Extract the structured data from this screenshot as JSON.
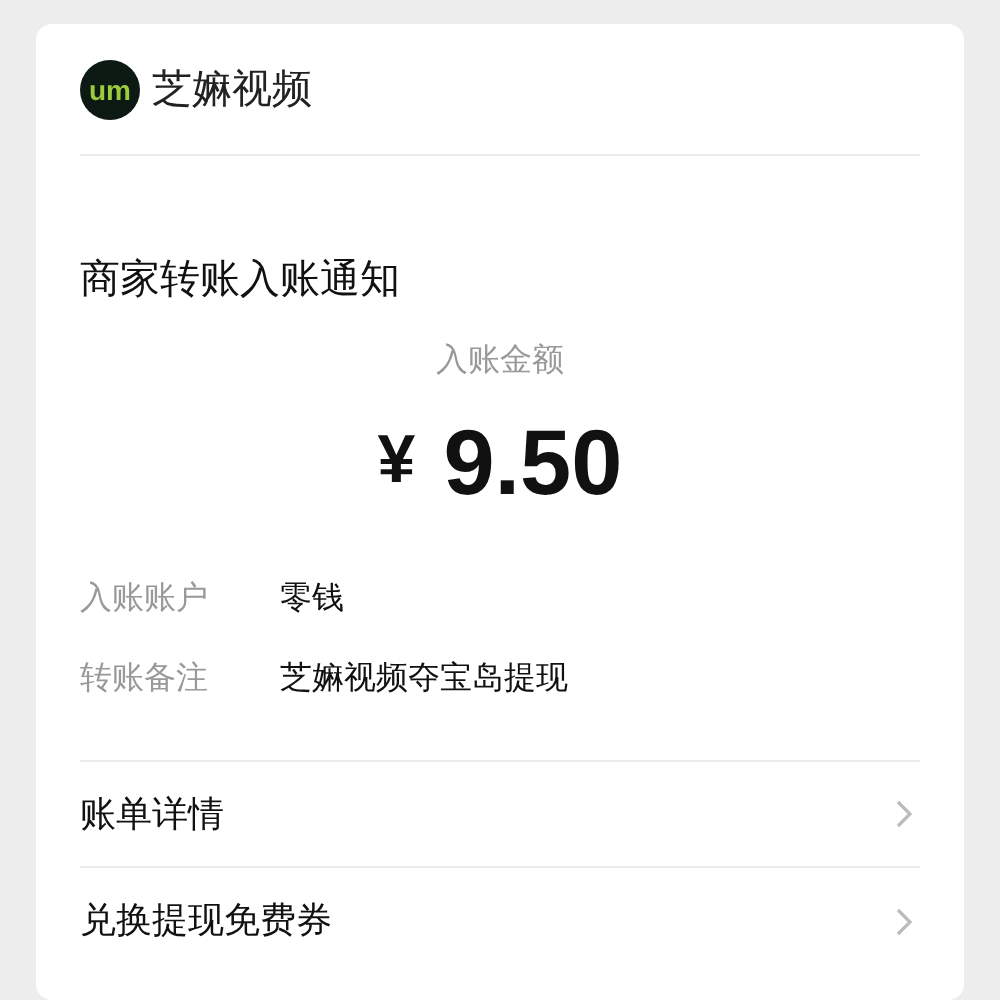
{
  "header": {
    "logo_text": "um",
    "app_name": "芝嫲视频"
  },
  "title": "商家转账入账通知",
  "amount": {
    "label": "入账金额",
    "currency": "¥",
    "value": "9.50"
  },
  "details": [
    {
      "label": "入账账户",
      "value": "零钱"
    },
    {
      "label": "转账备注",
      "value": "芝嫲视频夺宝岛提现"
    }
  ],
  "links": [
    {
      "label": "账单详情"
    },
    {
      "label": "兑换提现免费券"
    }
  ]
}
